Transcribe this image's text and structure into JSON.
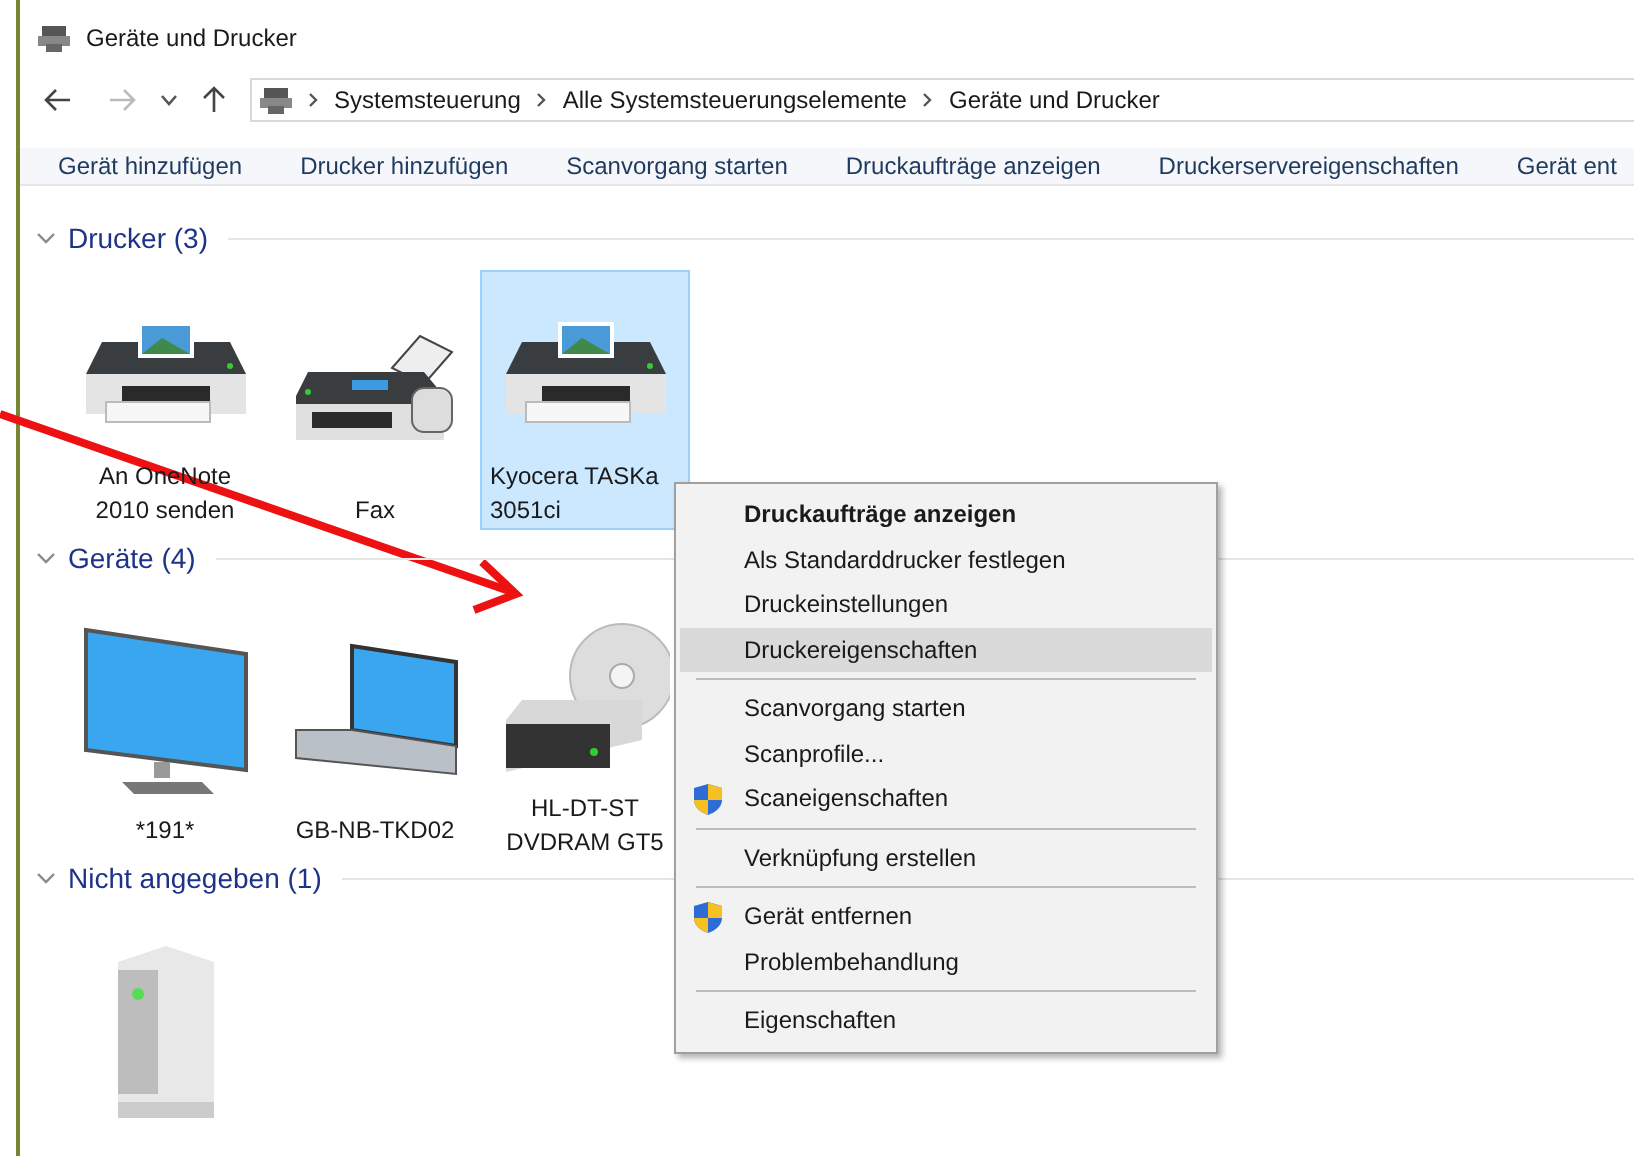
{
  "window": {
    "title": "Geräte und Drucker"
  },
  "breadcrumb": [
    "Systemsteuerung",
    "Alle Systemsteuerungselemente",
    "Geräte und Drucker"
  ],
  "toolbar": [
    "Gerät hinzufügen",
    "Drucker hinzufügen",
    "Scanvorgang starten",
    "Druckaufträge anzeigen",
    "Druckerservereigenschaften",
    "Gerät ent"
  ],
  "groups": [
    {
      "title": "Drucker (3)",
      "expanded": true,
      "items": [
        {
          "kind": "printer",
          "label": "An OneNote 2010 senden",
          "selected": false
        },
        {
          "kind": "fax",
          "label": "Fax",
          "selected": false
        },
        {
          "kind": "printer",
          "label": "Kyocera TASKa 3051ci",
          "selected": true
        }
      ]
    },
    {
      "title": "Geräte (4)",
      "expanded": true,
      "items": [
        {
          "kind": "monitor",
          "label": "*191*",
          "selected": false
        },
        {
          "kind": "laptop",
          "label": "GB-NB-TKD02",
          "selected": false
        },
        {
          "kind": "drive",
          "label": "HL-DT-ST DVDRAM GT5",
          "selected": false
        }
      ]
    },
    {
      "title": "Nicht angegeben (1)",
      "expanded": true,
      "items": [
        {
          "kind": "server"
        }
      ]
    }
  ],
  "context_menu": [
    {
      "kind": "item",
      "label": "Druckaufträge anzeigen",
      "bold": true,
      "selected": false
    },
    {
      "kind": "item",
      "label": "Als Standarddrucker festlegen",
      "bold": false,
      "selected": false
    },
    {
      "kind": "item",
      "label": "Druckeinstellungen",
      "bold": false,
      "selected": false
    },
    {
      "kind": "item",
      "label": "Druckereigenschaften",
      "bold": false,
      "selected": true
    },
    {
      "kind": "separator"
    },
    {
      "kind": "item",
      "label": "Scanvorgang starten",
      "bold": false,
      "selected": false
    },
    {
      "kind": "item",
      "label": "Scanprofile...",
      "bold": false,
      "selected": false
    },
    {
      "kind": "item",
      "label": "Scaneigenschaften",
      "bold": false,
      "selected": false,
      "shield": true
    },
    {
      "kind": "separator"
    },
    {
      "kind": "item",
      "label": "Verknüpfung erstellen",
      "bold": false,
      "selected": false
    },
    {
      "kind": "separator"
    },
    {
      "kind": "item",
      "label": "Gerät entfernen",
      "bold": false,
      "selected": false,
      "shield": true
    },
    {
      "kind": "item",
      "label": "Problembehandlung",
      "bold": false,
      "selected": false
    },
    {
      "kind": "separator"
    },
    {
      "kind": "item",
      "label": "Eigenschaften",
      "bold": false,
      "selected": false
    }
  ]
}
